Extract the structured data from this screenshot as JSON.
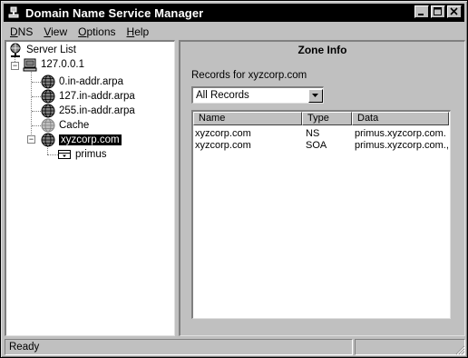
{
  "window": {
    "title": "Domain Name Service Manager"
  },
  "menubar": {
    "items": [
      {
        "label": "DNS",
        "underline": "D",
        "rest": "NS"
      },
      {
        "label": "View",
        "underline": "V",
        "rest": "iew"
      },
      {
        "label": "Options",
        "underline": "O",
        "rest": "ptions"
      },
      {
        "label": "Help",
        "underline": "H",
        "rest": "elp"
      }
    ]
  },
  "tree": {
    "root": {
      "label": "Server List",
      "icon": "server-list-icon"
    },
    "server": {
      "label": "127.0.0.1",
      "icon": "server-icon",
      "expanded": true
    },
    "zones": [
      {
        "label": "0.in-addr.arpa",
        "icon": "zone-globe-icon"
      },
      {
        "label": "127.in-addr.arpa",
        "icon": "zone-globe-icon"
      },
      {
        "label": "255.in-addr.arpa",
        "icon": "zone-globe-icon"
      },
      {
        "label": "Cache",
        "icon": "zone-globe-gray-icon"
      },
      {
        "label": "xyzcorp.com",
        "icon": "zone-globe-icon",
        "selected": true,
        "expanded": true
      }
    ],
    "subdomain": {
      "label": "primus",
      "icon": "domain-folder-icon"
    }
  },
  "zone_info": {
    "title": "Zone Info",
    "records_label": "Records for xyzcorp.com",
    "filter_value": "All Records",
    "columns": [
      "Name",
      "Type",
      "Data"
    ],
    "rows": [
      {
        "name": "xyzcorp.com",
        "type": "NS",
        "data": "primus.xyzcorp.com."
      },
      {
        "name": "xyzcorp.com",
        "type": "SOA",
        "data": "primus.xyzcorp.com.,"
      }
    ]
  },
  "status": {
    "text": "Ready"
  },
  "colors": {
    "face": "#c0c0c0",
    "shadow": "#808080",
    "highlight": "#ffffff",
    "title_bar": "#000000"
  }
}
